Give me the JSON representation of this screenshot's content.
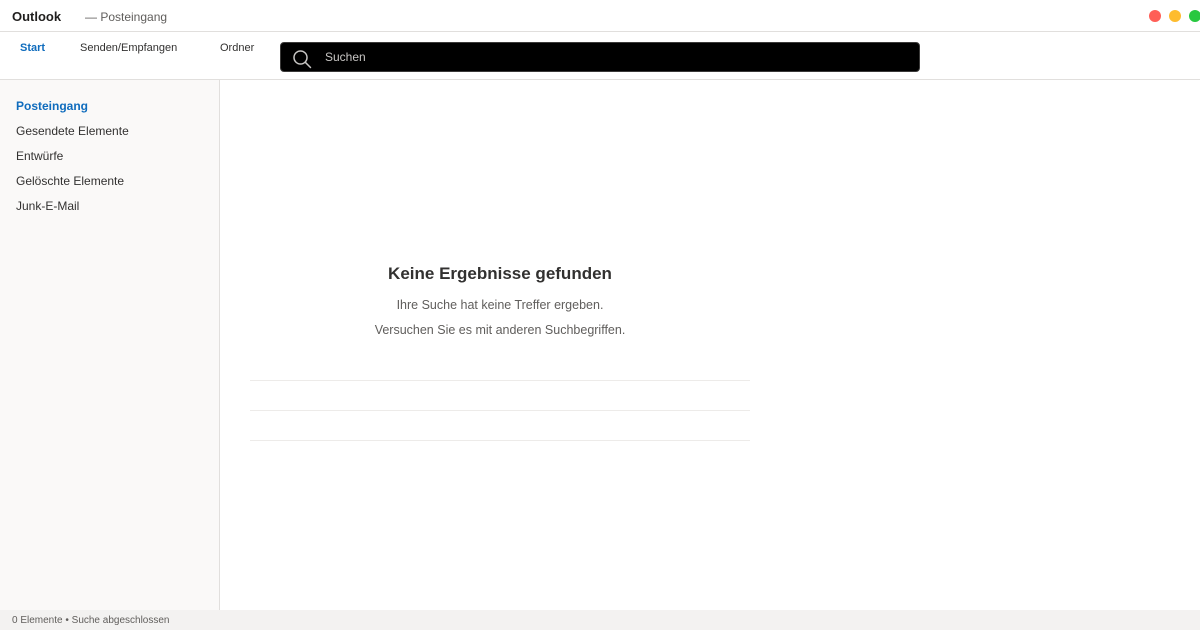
{
  "window": {
    "app_name": "Outlook",
    "title": "— Posteingang"
  },
  "ribbon": {
    "tabs": [
      {
        "label": "Start",
        "active": true
      },
      {
        "label": "Senden/Empfangen",
        "active": false
      },
      {
        "label": "Ordner",
        "active": false
      }
    ]
  },
  "search": {
    "value": "",
    "placeholder": "Suchen",
    "icon": "search-icon"
  },
  "sidebar": {
    "folders": [
      {
        "label": "Posteingang",
        "active": true
      },
      {
        "label": "Gesendete Elemente",
        "active": false
      },
      {
        "label": "Entwürfe",
        "active": false
      },
      {
        "label": "Gelöschte Elemente",
        "active": false
      },
      {
        "label": "Junk-E-Mail",
        "active": false
      }
    ]
  },
  "main": {
    "empty_title": "Keine Ergebnisse gefunden",
    "empty_line1": "Ihre Suche hat keine Treffer ergeben.",
    "empty_line2": "Versuchen Sie es mit anderen Suchbegriffen."
  },
  "status": {
    "text": "0 Elemente • Suche abgeschlossen"
  },
  "colors": {
    "accent": "#0f6cbd",
    "search_background": "#000000",
    "sidebar_background": "#faf9f8"
  }
}
